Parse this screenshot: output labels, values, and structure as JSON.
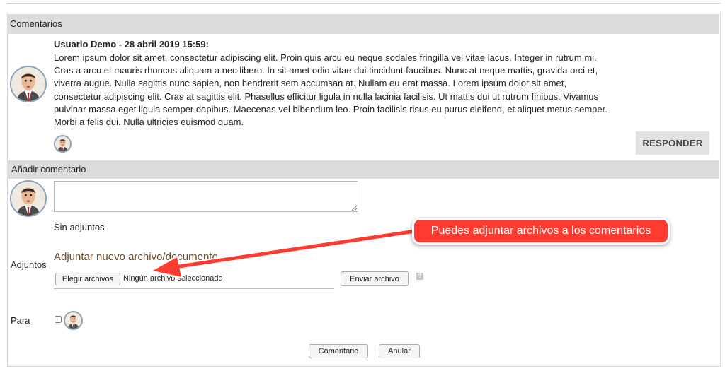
{
  "comments_section": {
    "title": "Comentarios",
    "comment": {
      "meta": "Usuario Demo - 28 abril 2019 15:59:",
      "lines": [
        "Lorem ipsum dolor sit amet, consectetur adipiscing elit. Proin quis arcu eu neque sodales fringilla vel vitae lacus. Integer in rutrum mi.",
        "Cras a arcu et mauris rhoncus aliquam a nec libero. In sit amet odio vitae dui tincidunt faucibus. Nunc at neque mattis, gravida orci et,",
        "viverra augue. Nulla sagittis nunc sapien, non hendrerit sem accumsan at. Nullam eu erat massa. Lorem ipsum dolor sit amet,",
        "consectetur adipiscing elit. Cras at sagittis elit. Phasellus efficitur ligula in nulla lacinia facilisis. Ut mattis dui ut rutrum finibus. Vivamus",
        "pulvinar massa eget ligula semper dapibus. Maecenas vel bibendum leo. Proin facilisis risus eu purus eleifend, et aliquet metus semper.",
        "Morbi a felis dui. Nulla ultricies euismod quam."
      ],
      "reply_label": "RESPONDER"
    }
  },
  "add_comment": {
    "title": "Añadir comentario",
    "textarea_value": "",
    "no_attachments": "Sin adjuntos",
    "attachments_label": "Adjuntos",
    "attach_title": "Adjuntar nuevo archivo/documento",
    "choose_files_label": "Elegir archivos",
    "no_file_selected": "Ningún archivo seleccionado",
    "send_file_label": "Enviar archivo",
    "help_icon": "?",
    "to_label": "Para",
    "submit_label": "Comentario",
    "cancel_label": "Anular"
  },
  "annotation": {
    "callout_text": "Puedes adjuntar archivos a los comentarios",
    "color": "#ff3b30"
  }
}
